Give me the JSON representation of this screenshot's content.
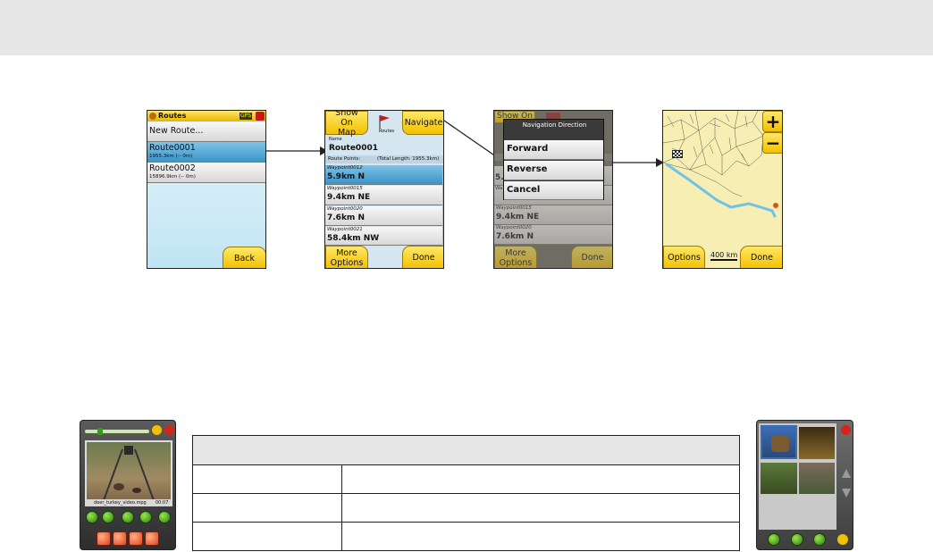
{
  "screen1": {
    "title": "Routes",
    "gps_badge": "GPS",
    "new_route": "New Route...",
    "routes": [
      {
        "name": "Route0001",
        "detail": "1955.3km (-- 0m)"
      },
      {
        "name": "Route0002",
        "detail": "15896.9km (-- 0m)"
      }
    ],
    "back_label": "Back"
  },
  "screen2": {
    "show_on_map": "Show On Map",
    "navigate": "Navigate",
    "routes_caption": "Routes",
    "name_caption": "Name",
    "route_name": "Route0001",
    "route_points_label": "Route Points:",
    "total_length": "(Total Length: 1955.3km)",
    "waypoints": [
      {
        "name": "Waypoint0012",
        "dist": "5.9km N"
      },
      {
        "name": "Waypoint0015",
        "dist": "9.4km NE"
      },
      {
        "name": "Waypoint0020",
        "dist": "7.6km N"
      },
      {
        "name": "Waypoint0021",
        "dist": "58.4km NW"
      }
    ],
    "more_options": "More Options",
    "done": "Done"
  },
  "screen3": {
    "show_on": "Show On",
    "partial_rows": [
      "Ro",
      "Nav",
      "Ro",
      "5.9",
      "Wa",
      "5.9",
      "Waypoint0015",
      "9.4km NE",
      "Waypoint0020",
      "7.6km N"
    ],
    "dialog_title": "Navigation Direction",
    "options": [
      "Forward",
      "Reverse",
      "Cancel"
    ],
    "more_options": "More Options",
    "done": "Done"
  },
  "screen4": {
    "zoom_in": "+",
    "zoom_out": "−",
    "options": "Options",
    "scale": "400 km",
    "done": "Done"
  },
  "player": {
    "filename": "deer_turkey_video.mpg",
    "time": "00:07"
  },
  "table": {
    "header": "",
    "rows": [
      {
        "col1": "",
        "col2": ""
      },
      {
        "col1": "",
        "col2": ""
      },
      {
        "col1": "",
        "col2": ""
      }
    ]
  },
  "colors": {
    "accent_yellow": "#f7cc1a",
    "select_blue": "#4aa3d6",
    "nav_green": "#3a9a18"
  }
}
